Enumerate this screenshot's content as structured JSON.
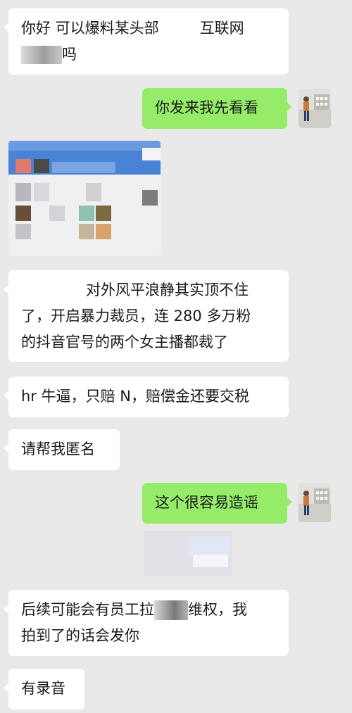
{
  "messages": {
    "m1_line1": "你好 可以爆料某头部",
    "m1_line1_end": "互联网",
    "m1_line2_end": "吗",
    "m2": "你发来我先看看",
    "m3_line1": "对外风平浪静其实顶不住",
    "m3_line2": "了，开启暴力裁员，连 280 多万粉",
    "m3_line3": "的抖音官号的两个女主播都裁了",
    "m4": "hr 牛逼，只赔 N，赔偿金还要交税",
    "m5": "请帮我匿名",
    "m6": "这个很容易造谣",
    "m7_line1": "后续可能会有员工拉",
    "m7_line1_end": "维权，我",
    "m7_line2": "拍到了的话会发你",
    "m8": "有录音"
  },
  "colors": {
    "background": "#e9e9e9",
    "incoming_bubble": "#ffffff",
    "outgoing_bubble": "#95ec69",
    "text": "#1a1a1a"
  }
}
